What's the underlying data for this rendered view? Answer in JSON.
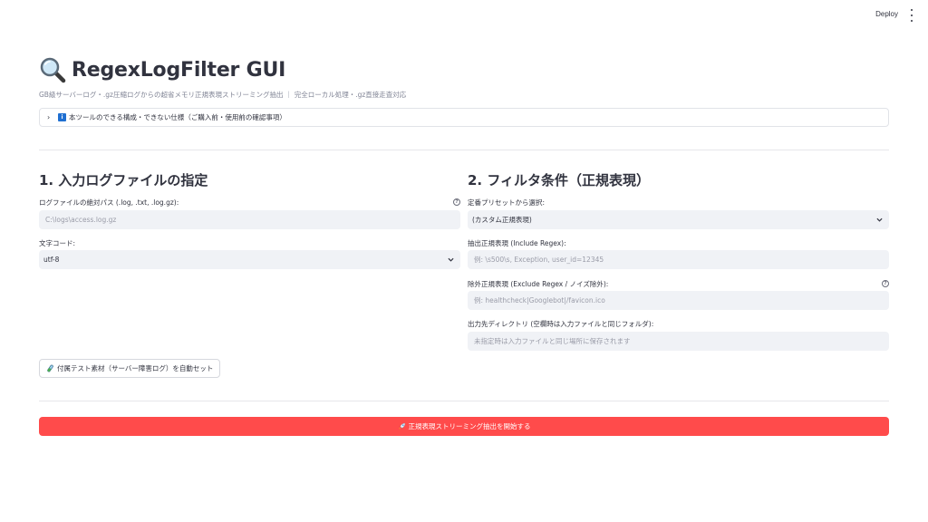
{
  "topbar": {
    "deploy_label": "Deploy"
  },
  "header": {
    "title": "RegexLogFilter GUI",
    "subtitle": "GB級サーバーログ・.gz圧縮ログからの超省メモリ正規表現ストリーミング抽出 ｜ 完全ローカル処理・.gz直接走査対応"
  },
  "expander": {
    "info_glyph": "i",
    "label": "本ツールのできる構成・できない仕様（ご購入前・使用前の確認事項）"
  },
  "left": {
    "section_title": "1. 入力ログファイルの指定",
    "path_label": "ログファイルの絶対パス (.log, .txt, .log.gz):",
    "path_placeholder": "C:\\logs\\access.log.gz",
    "encoding_label": "文字コード:",
    "encoding_value": "utf-8",
    "sample_button": "付属テスト素材（サーバー障害ログ）を自動セット"
  },
  "right": {
    "section_title": "2. フィルタ条件（正規表現）",
    "preset_label": "定番プリセットから選択:",
    "preset_value": "(カスタム正規表現)",
    "include_label": "抽出正規表現 (Include Regex):",
    "include_placeholder": "例: \\s500\\s, Exception, user_id=12345",
    "exclude_label": "除外正規表現 (Exclude Regex / ノイズ除外):",
    "exclude_placeholder": "例: healthcheck|Googlebot|/favicon.ico",
    "output_label": "出力先ディレクトリ (空欄時は入力ファイルと同じフォルダ):",
    "output_placeholder": "未指定時は入力ファイルと同じ場所に保存されます"
  },
  "actions": {
    "start_button": "正規表現ストリーミング抽出を開始する"
  },
  "colors": {
    "primary": "#ff4b4b",
    "input_bg": "#f0f2f6",
    "text": "#31333f",
    "muted": "#808495",
    "info_blue": "#1f6fd1"
  }
}
